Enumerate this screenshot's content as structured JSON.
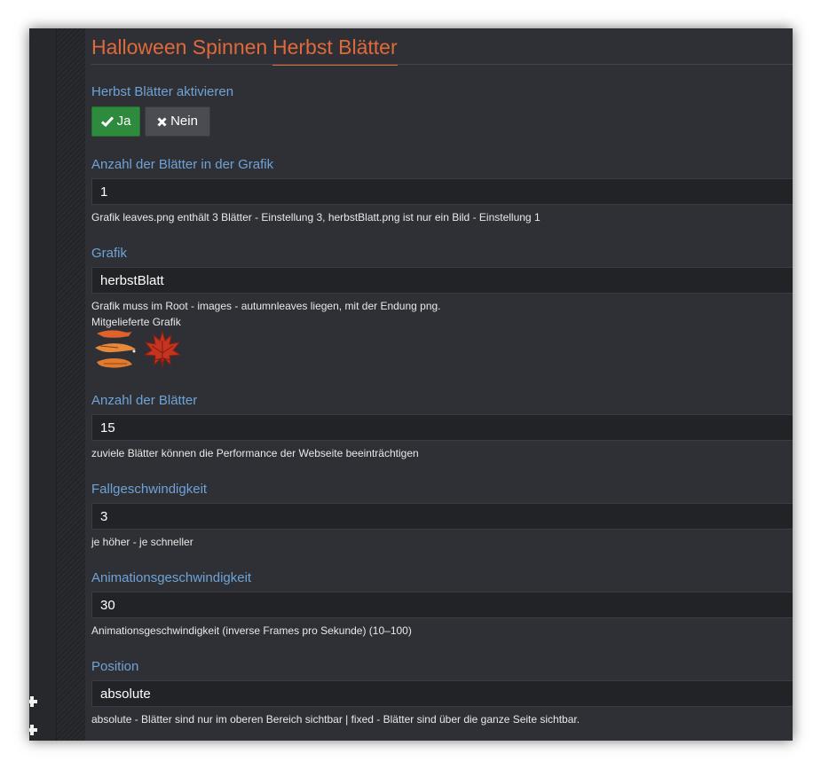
{
  "tabs": [
    "Halloween Spinnen",
    "Herbst Blätter"
  ],
  "activate": {
    "label": "Herbst Blätter aktivieren",
    "yes_label": "Ja",
    "no_label": "Nein",
    "selected": "Ja",
    "yes_color": "#2e8a3c"
  },
  "leaves_in_graphic": {
    "label": "Anzahl der Blätter in der Grafik",
    "value": "1",
    "help": "Grafik leaves.png enthält 3 Blätter - Einstellung 3, herbstBlatt.png ist nur ein Bild - Einstellung 1"
  },
  "graphic": {
    "label": "Grafik",
    "value": "herbstBlatt",
    "help": "Grafik muss im Root - images - autumnleaves liegen, mit der Endung png.",
    "supplied_label": "Mitgelieferte Grafik",
    "images": [
      "leaves-strip-image",
      "maple-leaf-image"
    ]
  },
  "leaf_count": {
    "label": "Anzahl der Blätter",
    "value": "15",
    "help": "zuviele Blätter können die Performance der Webseite beeinträchtigen"
  },
  "fall_speed": {
    "label": "Fallgeschwindigkeit",
    "value": "3",
    "help": "je höher - je schneller"
  },
  "animation_speed": {
    "label": "Animationsgeschwindigkeit",
    "value": "30",
    "help": "Animationsgeschwindigkeit (inverse Frames pro Sekunde) (10–100)"
  },
  "position": {
    "label": "Position",
    "value": "absolute",
    "help": "absolute - Blätter sind nur im oberen Bereich sichtbar | fixed - Blätter sind über die ganze Seite sichtbar."
  },
  "colors": {
    "accent_orange": "#e0693a",
    "label_blue": "#6fa3d6",
    "background": "#2f3035",
    "input_background": "#222327"
  }
}
